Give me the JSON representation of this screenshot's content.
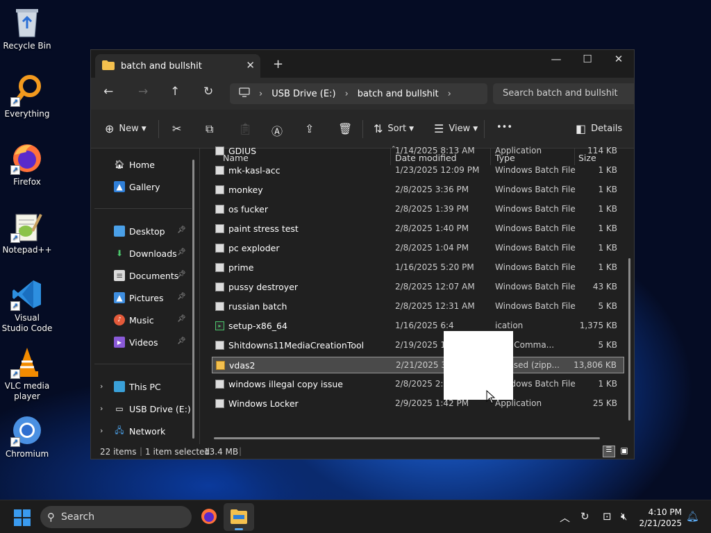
{
  "desktop": {
    "icons": [
      {
        "label": "Recycle Bin"
      },
      {
        "label": "Everything"
      },
      {
        "label": "Firefox"
      },
      {
        "label": "Notepad++"
      },
      {
        "label": "Visual Studio Code"
      },
      {
        "label": "VLC media player"
      },
      {
        "label": "Chromium"
      }
    ]
  },
  "window": {
    "tab_title": "batch and bullshit",
    "new_tab": "+",
    "controls": {
      "minimize": "—",
      "maximize": "☐",
      "close": "✕"
    },
    "address": {
      "crumbs": [
        "USB Drive (E:)",
        "batch and bullshit"
      ],
      "sep": "›"
    },
    "search_placeholder": "Search batch and bullshit",
    "toolbar": {
      "new": "New",
      "sort": "Sort",
      "view": "View",
      "more": "•••",
      "details": "Details"
    },
    "sidebar": {
      "quick": [
        {
          "label": "Home",
          "icon": "home-icon"
        },
        {
          "label": "Gallery",
          "icon": "gallery-icon"
        }
      ],
      "pinned": [
        {
          "label": "Desktop",
          "icon": "desktop-icon"
        },
        {
          "label": "Downloads",
          "icon": "downloads-icon"
        },
        {
          "label": "Documents",
          "icon": "documents-icon"
        },
        {
          "label": "Pictures",
          "icon": "pictures-icon"
        },
        {
          "label": "Music",
          "icon": "music-icon"
        },
        {
          "label": "Videos",
          "icon": "videos-icon"
        }
      ],
      "tree": [
        {
          "label": "This PC"
        },
        {
          "label": "USB Drive (E:)"
        },
        {
          "label": "Network"
        }
      ]
    },
    "columns": {
      "name": "Name",
      "date": "Date modified",
      "type": "Type",
      "size": "Size"
    },
    "files": [
      {
        "name": "GDIUS",
        "date": "1/14/2025 8:13 AM",
        "type": "Application",
        "size": "114 KB",
        "kind": "app"
      },
      {
        "name": "mk-kasl-acc",
        "date": "1/23/2025 12:09 PM",
        "type": "Windows Batch File",
        "size": "1 KB",
        "kind": "bat"
      },
      {
        "name": "monkey",
        "date": "2/8/2025 3:36 PM",
        "type": "Windows Batch File",
        "size": "1 KB",
        "kind": "bat"
      },
      {
        "name": "os fucker",
        "date": "2/8/2025 1:39 PM",
        "type": "Windows Batch File",
        "size": "1 KB",
        "kind": "bat"
      },
      {
        "name": "paint stress test",
        "date": "2/8/2025 1:40 PM",
        "type": "Windows Batch File",
        "size": "1 KB",
        "kind": "bat"
      },
      {
        "name": "pc exploder",
        "date": "2/8/2025 1:04 PM",
        "type": "Windows Batch File",
        "size": "1 KB",
        "kind": "bat"
      },
      {
        "name": "prime",
        "date": "1/16/2025 5:20 PM",
        "type": "Windows Batch File",
        "size": "1 KB",
        "kind": "bat"
      },
      {
        "name": "pussy destroyer",
        "date": "2/8/2025 12:07 AM",
        "type": "Windows Batch File",
        "size": "43 KB",
        "kind": "bat"
      },
      {
        "name": "russian batch",
        "date": "2/8/2025 12:31 AM",
        "type": "Windows Batch File",
        "size": "5 KB",
        "kind": "bat"
      },
      {
        "name": "setup-x86_64",
        "date": "1/16/2025 6:4",
        "type": "ication",
        "size": "1,375 KB",
        "kind": "setup"
      },
      {
        "name": "Shitdowns11MediaCreationTool",
        "date": "2/19/2025 12:",
        "type": "ows Comma...",
        "size": "5 KB",
        "kind": "bat"
      },
      {
        "name": "vdas2",
        "date": "2/21/2025 3:0",
        "type": "pressed (zipp...",
        "size": "13,806 KB",
        "kind": "zip"
      },
      {
        "name": "windows illegal copy issue",
        "date": "2/8/2025 2:14 PM",
        "type": "Windows Batch File",
        "size": "1 KB",
        "kind": "bat"
      },
      {
        "name": "Windows Locker",
        "date": "2/9/2025 1:42 PM",
        "type": "Application",
        "size": "25 KB",
        "kind": "app"
      }
    ],
    "status": {
      "count": "22 items",
      "selected": "1 item selected",
      "size": "13.4 MB"
    }
  },
  "taskbar": {
    "search_label": "Search",
    "time": "4:10 PM",
    "date": "2/21/2025"
  },
  "colors": {
    "accent": "#0078d4",
    "selection": "#4a4a4a",
    "window_bg": "#202020"
  }
}
